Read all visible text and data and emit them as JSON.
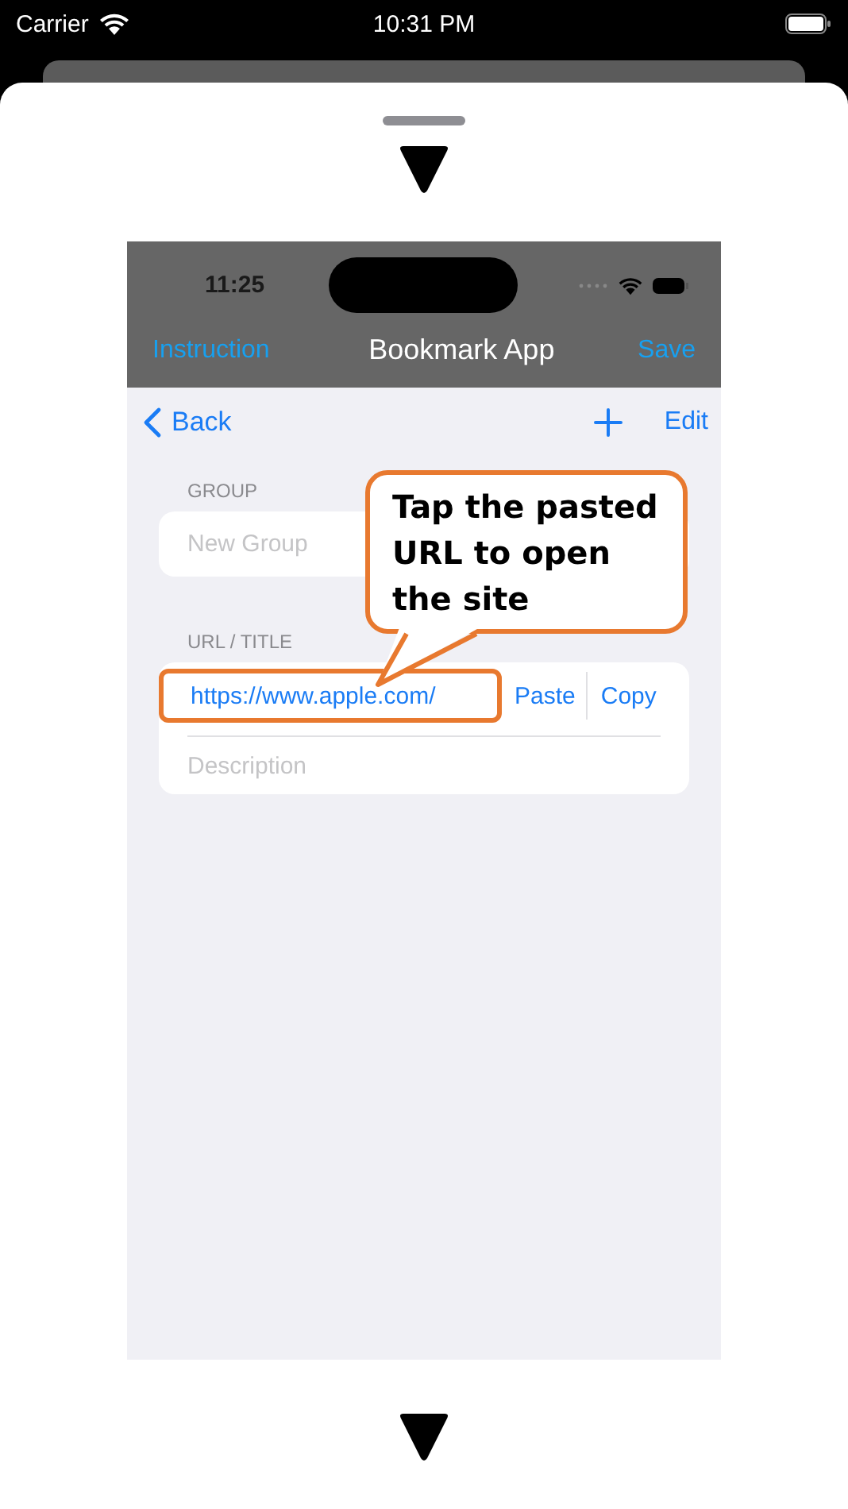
{
  "status_bar": {
    "carrier": "Carrier",
    "time": "10:31 PM"
  },
  "preview": {
    "status_time": "11:25",
    "nav": {
      "left": "Instruction",
      "title": "Bookmark App",
      "right": "Save"
    },
    "toolbar": {
      "back": "Back",
      "edit": "Edit"
    },
    "group": {
      "label": "GROUP",
      "placeholder": "New Group"
    },
    "url_section": {
      "label": "URL / TITLE",
      "url": "https://www.apple.com/",
      "highlighted": true,
      "paste": "Paste",
      "copy": "Copy",
      "placeholder": "Description"
    },
    "callout": "Tap the pasted URL to open the site"
  }
}
